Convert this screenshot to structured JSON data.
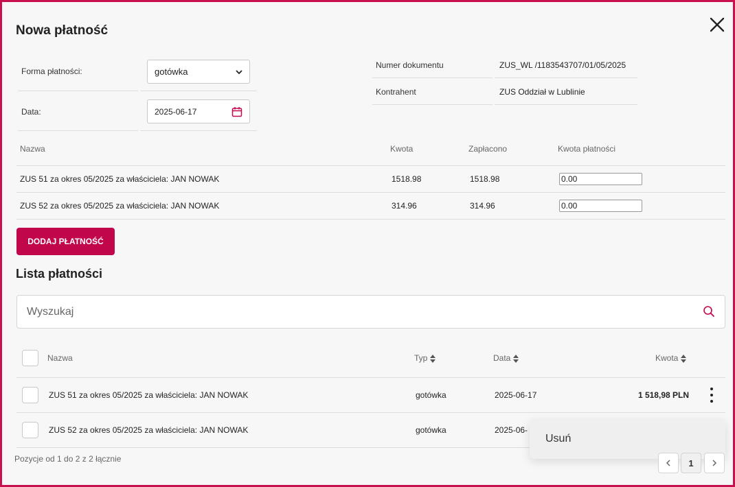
{
  "dialog": {
    "title": "Nowa płatność",
    "form": {
      "payment_method_label": "Forma płatności:",
      "payment_method_value": "gotówka",
      "date_label": "Data:",
      "date_value": "2025-06-17"
    },
    "document": {
      "number_label": "Numer dokumentu",
      "number_value": "ZUS_WL /1183543707/01/05/2025",
      "contractor_label": "Kontrahent",
      "contractor_value": "ZUS Oddział w Lublinie"
    },
    "items_table": {
      "headers": [
        "Nazwa",
        "Kwota",
        "Zapłacono",
        "Kwota płatności"
      ],
      "rows": [
        {
          "name": "ZUS 51 za okres 05/2025 za właściciela: JAN NOWAK",
          "amount": "1518.98",
          "paid": "1518.98",
          "payment": "0.00"
        },
        {
          "name": "ZUS 52 za okres 05/2025 za właściciela: JAN NOWAK",
          "amount": "314.96",
          "paid": "314.96",
          "payment": "0.00"
        }
      ]
    },
    "add_button": "DODAJ PŁATNOŚĆ",
    "list": {
      "title": "Lista płatności",
      "search_placeholder": "Wyszukaj",
      "headers": {
        "name": "Nazwa",
        "type": "Typ",
        "date": "Data",
        "amount": "Kwota"
      },
      "rows": [
        {
          "name": "ZUS 51 za okres 05/2025 za właściciela: JAN NOWAK",
          "type": "gotówka",
          "date": "2025-06-17",
          "amount": "1 518,98 PLN"
        },
        {
          "name": "ZUS 52 za okres 05/2025 za właściciela: JAN NOWAK",
          "type": "gotówka",
          "date": "2025-06-"
        }
      ],
      "summary": "Pozycje od 1 do 2 z 2 łącznie",
      "current_page": "1"
    },
    "context_menu": {
      "delete_label": "Usuń"
    }
  },
  "colors": {
    "accent": "#c2064c",
    "frame": "#c8104f"
  },
  "icons": {
    "close": "close-icon",
    "calendar": "calendar-icon",
    "search": "search-icon",
    "sort": "sort-icon",
    "kebab": "kebab-menu-icon"
  }
}
